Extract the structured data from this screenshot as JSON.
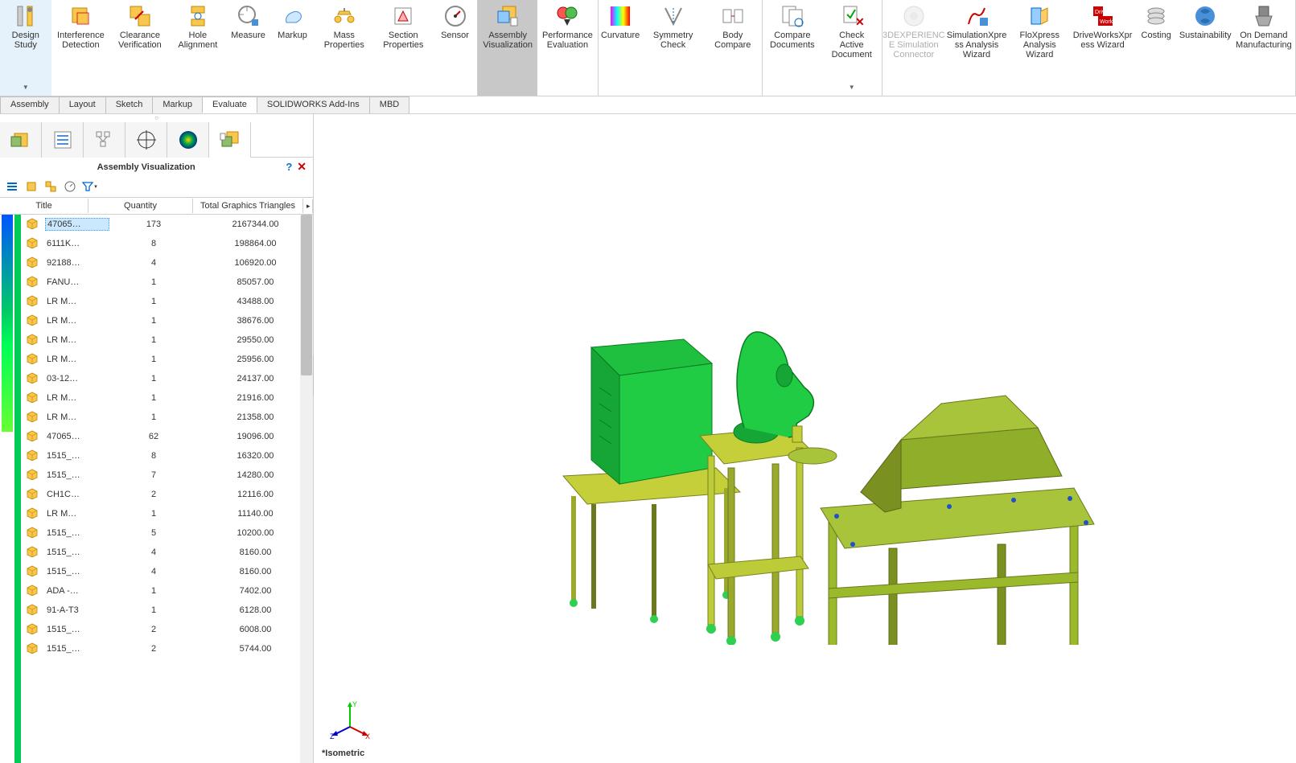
{
  "ribbon": {
    "items": [
      {
        "label": "Design Study",
        "dropdown": true
      },
      {
        "label": "Interference Detection"
      },
      {
        "label": "Clearance Verification"
      },
      {
        "label": "Hole Alignment"
      },
      {
        "label": "Measure"
      },
      {
        "label": "Markup"
      },
      {
        "label": "Mass Properties"
      },
      {
        "label": "Section Properties"
      },
      {
        "label": "Sensor"
      },
      {
        "label": "Assembly Visualization",
        "active": true
      },
      {
        "label": "Performance Evaluation"
      },
      {
        "label": "Curvature"
      },
      {
        "label": "Symmetry Check"
      },
      {
        "label": "Body Compare"
      },
      {
        "label": "Compare Documents"
      },
      {
        "label": "Check Active Document",
        "dropdown": true
      },
      {
        "label": "3DEXPERIENCE Simulation Connector",
        "disabled": true
      },
      {
        "label": "SimulationXpress Analysis Wizard"
      },
      {
        "label": "FloXpress Analysis Wizard"
      },
      {
        "label": "DriveWorksXpress Wizard"
      },
      {
        "label": "Costing"
      },
      {
        "label": "Sustainability"
      },
      {
        "label": "On Demand Manufacturing"
      }
    ],
    "group_breaks": [
      9,
      11,
      14,
      16
    ]
  },
  "tabs": [
    "Assembly",
    "Layout",
    "Sketch",
    "Markup",
    "Evaluate",
    "SOLIDWORKS Add-Ins",
    "MBD"
  ],
  "active_tab": "Evaluate",
  "panel": {
    "title": "Assembly Visualization",
    "columns": [
      "Title",
      "Quantity",
      "Total Graphics Triangles"
    ],
    "rows": [
      {
        "title": "47065…",
        "qty": "173",
        "tri": "2167344.00",
        "selected": true
      },
      {
        "title": "6111K…",
        "qty": "8",
        "tri": "198864.00"
      },
      {
        "title": "92188…",
        "qty": "4",
        "tri": "106920.00"
      },
      {
        "title": "FANU…",
        "qty": "1",
        "tri": "85057.00"
      },
      {
        "title": "LR M…",
        "qty": "1",
        "tri": "43488.00"
      },
      {
        "title": "LR M…",
        "qty": "1",
        "tri": "38676.00"
      },
      {
        "title": "LR M…",
        "qty": "1",
        "tri": "29550.00"
      },
      {
        "title": "LR M…",
        "qty": "1",
        "tri": "25956.00"
      },
      {
        "title": "03-12…",
        "qty": "1",
        "tri": "24137.00"
      },
      {
        "title": "LR M…",
        "qty": "1",
        "tri": "21916.00"
      },
      {
        "title": "LR M…",
        "qty": "1",
        "tri": "21358.00"
      },
      {
        "title": "47065…",
        "qty": "62",
        "tri": "19096.00"
      },
      {
        "title": "1515_…",
        "qty": "8",
        "tri": "16320.00"
      },
      {
        "title": "1515_…",
        "qty": "7",
        "tri": "14280.00"
      },
      {
        "title": "CH1C…",
        "qty": "2",
        "tri": "12116.00"
      },
      {
        "title": "LR M…",
        "qty": "1",
        "tri": "11140.00"
      },
      {
        "title": "1515_…",
        "qty": "5",
        "tri": "10200.00"
      },
      {
        "title": "1515_…",
        "qty": "4",
        "tri": "8160.00"
      },
      {
        "title": "1515_…",
        "qty": "4",
        "tri": "8160.00"
      },
      {
        "title": "ADA -…",
        "qty": "1",
        "tri": "7402.00"
      },
      {
        "title": "91-A-T3",
        "qty": "1",
        "tri": "6128.00"
      },
      {
        "title": "1515_…",
        "qty": "2",
        "tri": "6008.00"
      },
      {
        "title": "1515_…",
        "qty": "2",
        "tri": "5744.00"
      }
    ]
  },
  "view_label": "*Isometric",
  "triad": {
    "x": "X",
    "y": "Y",
    "z": "Z"
  }
}
